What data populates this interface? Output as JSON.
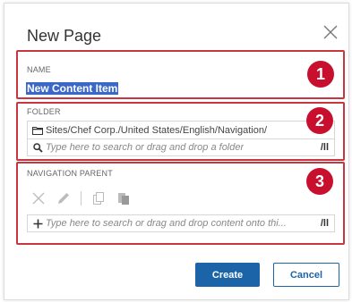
{
  "dialog": {
    "title": "New Page",
    "close_icon": "close-icon"
  },
  "name_section": {
    "label": "NAME",
    "value": "New Content Item",
    "badge": "1"
  },
  "folder_section": {
    "label": "FOLDER",
    "path": "Sites/Chef Corp./United States/English/Navigation/",
    "search_placeholder": "Type here to search or drag and drop a folder",
    "browse_label": "/ll",
    "badge": "2"
  },
  "nav_section": {
    "label": "NAVIGATION PARENT",
    "search_placeholder": "Type here to search or drag and drop content onto thi...",
    "browse_label": "/ll",
    "badge": "3",
    "tools": [
      "close-icon",
      "pencil-icon",
      "copy-icon",
      "paste-icon"
    ]
  },
  "footer": {
    "create_label": "Create",
    "cancel_label": "Cancel"
  },
  "colors": {
    "highlight": "#c8373f",
    "badge": "#c8102e",
    "primary": "#1c64a8",
    "selection": "#3b68c8"
  }
}
